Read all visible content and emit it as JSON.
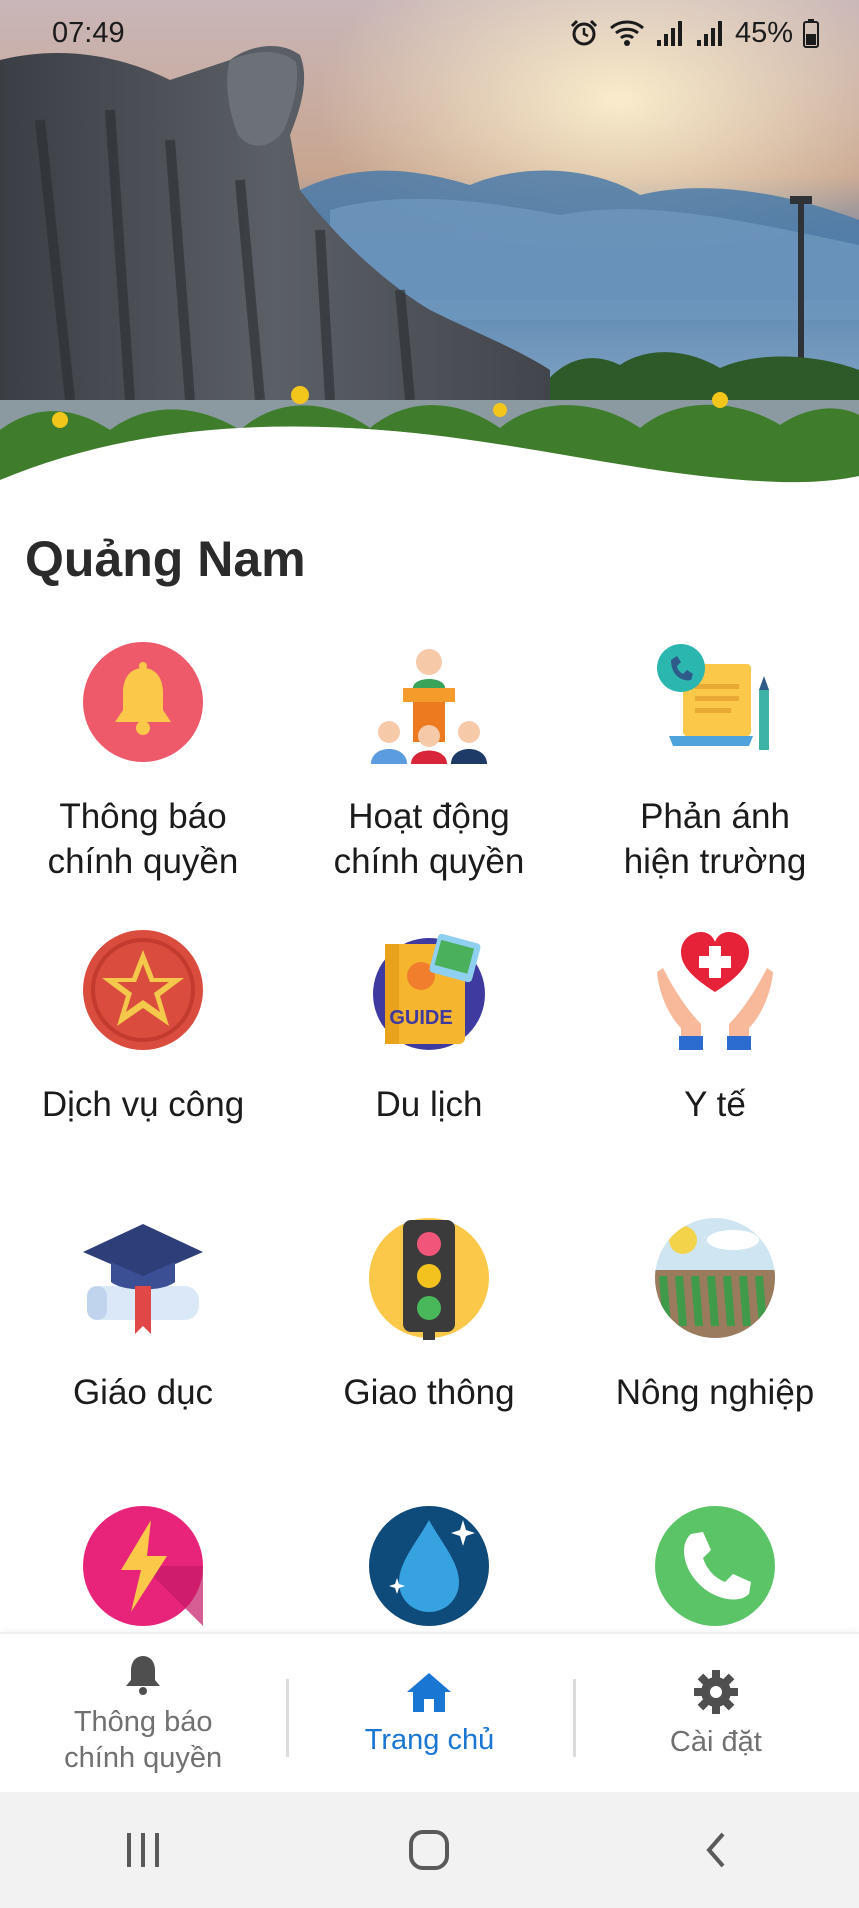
{
  "status_bar": {
    "time": "07:49",
    "battery": "45%",
    "icons": [
      "alarm-icon",
      "wifi-icon",
      "signal-icon",
      "signal-icon",
      "battery-icon"
    ]
  },
  "header": {
    "region_title": "Quảng Nam"
  },
  "tiles": [
    {
      "label": "Thông báo\nchính quyền",
      "icon": "bell-icon"
    },
    {
      "label": "Hoạt động\nchính quyền",
      "icon": "podium-people-icon"
    },
    {
      "label": "Phản ánh\nhiện trường",
      "icon": "report-phone-icon"
    },
    {
      "label": "Dịch vụ công",
      "icon": "public-service-star-icon"
    },
    {
      "label": "Du lịch",
      "icon": "travel-guide-icon",
      "badge": "GUIDE"
    },
    {
      "label": "Y tế",
      "icon": "health-hands-heart-icon"
    },
    {
      "label": "Giáo dục",
      "icon": "graduation-cap-icon"
    },
    {
      "label": "Giao thông",
      "icon": "traffic-light-icon"
    },
    {
      "label": "Nông nghiệp",
      "icon": "farm-field-icon"
    },
    {
      "label": "",
      "icon": "electricity-icon"
    },
    {
      "label": "",
      "icon": "water-drop-icon"
    },
    {
      "label": "",
      "icon": "phone-icon"
    }
  ],
  "bottom_nav": {
    "items": [
      {
        "label": "Thông báo\nchính quyền",
        "icon": "bell-icon",
        "active": false
      },
      {
        "label": "Trang chủ",
        "icon": "home-icon",
        "active": true
      },
      {
        "label": "Cài đặt",
        "icon": "gear-icon",
        "active": false
      }
    ]
  },
  "system_nav": {
    "buttons": [
      "recent-apps-icon",
      "home-circle-icon",
      "back-icon"
    ]
  },
  "colors": {
    "accent": "#1976d2",
    "bell_bg": "#ef5a6b",
    "bell": "#fcc84a",
    "star_bg": "#d94c3e",
    "bolt_bg": "#e8247a",
    "water_bg": "#0e4a7a",
    "phone_bg": "#5bc466"
  }
}
